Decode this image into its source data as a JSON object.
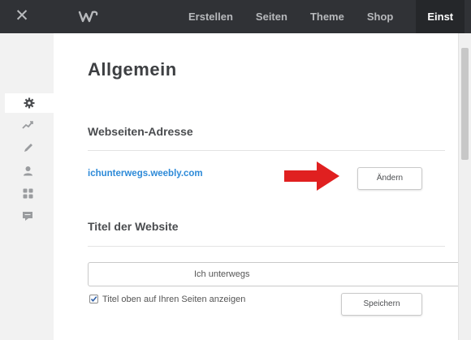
{
  "topbar": {
    "close_icon": "close-icon",
    "logo_icon": "weebly-logo-icon",
    "nav": [
      "Erstellen",
      "Seiten",
      "Theme",
      "Shop",
      "Einst"
    ],
    "active_nav_index": 4,
    "colors": {
      "background": "#303236",
      "text": "#b7b9bc",
      "active_background": "#25272a"
    }
  },
  "sidebar": {
    "icons": [
      "gear-icon",
      "trend-icon",
      "pencil-icon",
      "user-icon",
      "apps-icon",
      "comment-icon"
    ],
    "active_index": 0
  },
  "main": {
    "title": "Allgemein",
    "address": {
      "heading": "Webseiten-Adresse",
      "url": "ichunterwegs.weebly.com",
      "change_button": "Ändern"
    },
    "site_title": {
      "heading": "Titel der Website",
      "value": "Ich unterwegs",
      "checkbox_label": "Titel oben auf Ihren Seiten anzeigen",
      "checkbox_checked": true,
      "save_button": "Speichern"
    }
  },
  "annotation": {
    "arrow_icon": "red-arrow-icon",
    "color": "#e02020"
  },
  "accent_color": "#2d8ad8"
}
